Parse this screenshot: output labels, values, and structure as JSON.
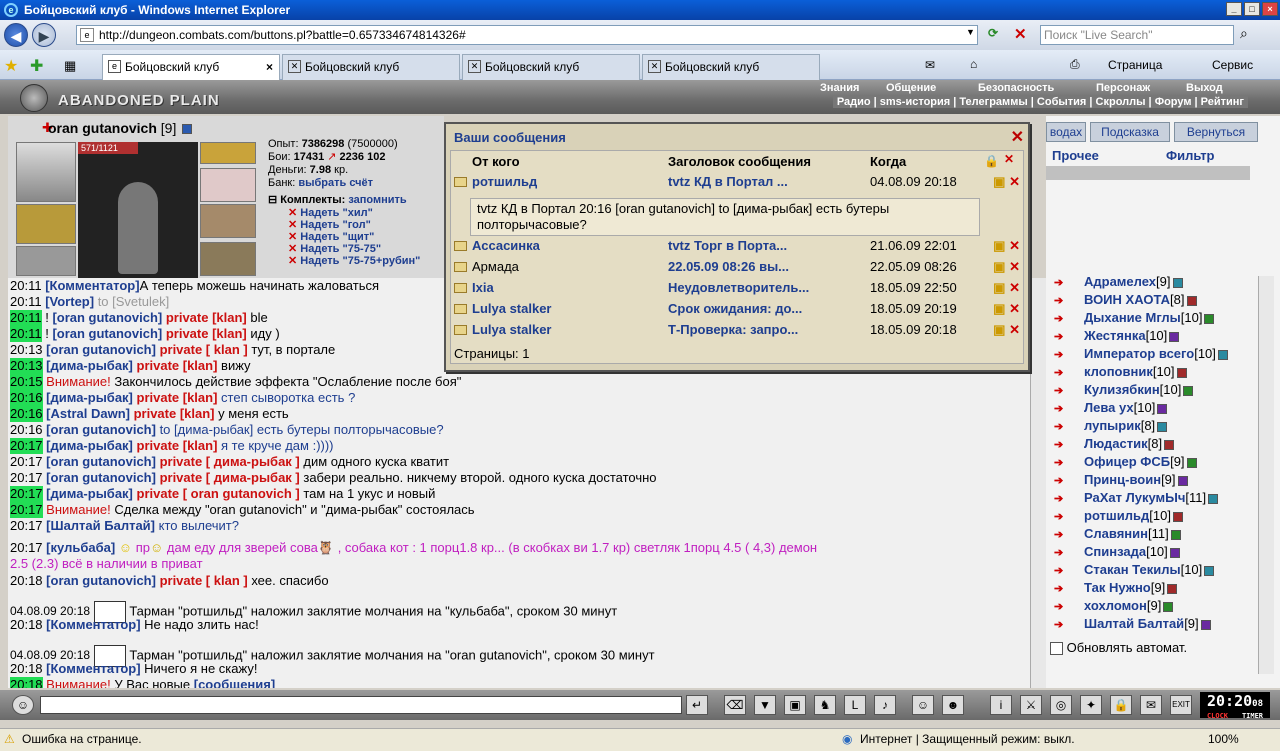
{
  "window": {
    "title": "Бойцовский клуб - Windows Internet Explorer",
    "min": "_",
    "max": "□",
    "close": "×"
  },
  "browser": {
    "url": "http://dungeon.combats.com/buttons.pl?battle=0.657334674814326#",
    "search_placeholder": "Поиск \"Live Search\"",
    "tabs": [
      "Бойцовский клуб",
      "Бойцовский клуб",
      "Бойцовский клуб",
      "Бойцовский клуб"
    ],
    "tab_close": "×",
    "page_menu": "Страница",
    "service_menu": "Сервис"
  },
  "game": {
    "logo": "ABANDONED PLAIN",
    "menu": [
      "Знания",
      "Общение",
      "Безопасность",
      "Персонаж",
      "Выход"
    ],
    "submenu": "Радио | sms-история | Телеграммы | События | Скроллы | Форум | Рейтинг"
  },
  "character": {
    "name": "oran gutanovich",
    "level": "[9]",
    "hp": "571/1121",
    "exp_label": "Опыт:",
    "exp": "7386298",
    "exp_next": "(7500000)",
    "fights_label": "Бои:",
    "wins": "17431",
    "losses": "2236",
    "draws": "102",
    "money_label": "Деньги:",
    "money": "7.98",
    "money_unit": "кр.",
    "bank_label": "Банк:",
    "bank_link": "выбрать счёт",
    "sets_label": "Комплекты:",
    "sets_remember": "запомнить",
    "sets": [
      "Надеть \"хил\"",
      "Надеть \"гол\"",
      "Надеть \"щит\"",
      "Надеть \"75-75\"",
      "Надеть \"75-75+рубин\""
    ]
  },
  "right_panel": {
    "btn_left": "водах",
    "btn_hint": "Подсказка",
    "btn_back": "Вернуться",
    "tab_other": "Прочее",
    "tab_filter": "Фильтр",
    "users": [
      {
        "name": "Адрамелех",
        "level": "[9]"
      },
      {
        "name": "ВОИН ХАОТА",
        "level": "[8]"
      },
      {
        "name": "Дыхание Мглы",
        "level": "[10]"
      },
      {
        "name": "Жестянка",
        "level": "[10]"
      },
      {
        "name": "Император всего",
        "level": "[10]"
      },
      {
        "name": "клоповник",
        "level": "[10]"
      },
      {
        "name": "Кулизябкин",
        "level": "[10]"
      },
      {
        "name": "Лева ух",
        "level": "[10]"
      },
      {
        "name": "лупырик",
        "level": "[8]"
      },
      {
        "name": "Людастик",
        "level": "[8]"
      },
      {
        "name": "Офицер ФСБ",
        "level": "[9]"
      },
      {
        "name": "Принц-воин",
        "level": "[9]"
      },
      {
        "name": "РаХат ЛукумЫч",
        "level": "[11]"
      },
      {
        "name": "ротшильд",
        "level": "[10]"
      },
      {
        "name": "Славянин",
        "level": "[11]"
      },
      {
        "name": "Спинзада",
        "level": "[10]"
      },
      {
        "name": "Стакан Текилы",
        "level": "[10]"
      },
      {
        "name": "Так Нужно",
        "level": "[9]"
      },
      {
        "name": "хохломон",
        "level": "[9]"
      },
      {
        "name": "Шалтай Балтай",
        "level": "[9]"
      }
    ],
    "auto_refresh": "Обновлять автомат."
  },
  "messages": {
    "title": "Ваши сообщения",
    "col_from": "От кого",
    "col_subject": "Заголовок сообщения",
    "col_when": "Когда",
    "rows": [
      {
        "from": "ротшильд",
        "subject": "tvtz КД в Портал ...",
        "when": "04.08.09 20:18"
      },
      {
        "from": "Ассасинка",
        "subject": "tvtz Торг в Порта...",
        "when": "21.06.09 22:01"
      },
      {
        "from": "Армада",
        "subject": "22.05.09 08:26 вы...",
        "when": "22.05.09 08:26"
      },
      {
        "from": "Ixia",
        "subject": "Неудовлетворитель...",
        "when": "18.05.09 22:50"
      },
      {
        "from": "Lulya stalker",
        "subject": "Срок ожидания: до...",
        "when": "18.05.09 20:19"
      },
      {
        "from": "Lulya stalker",
        "subject": "Т-Проверка: запро...",
        "when": "18.05.09 20:18"
      }
    ],
    "expanded_text": "tvtz КД в Портал 20:16 [oran gutanovich] to [дима-рыбак] есть бутеры полторычасовые?",
    "pages": "Страницы: 1"
  },
  "chat": [
    {
      "t": "20:11",
      "parts": [
        [
          "nm",
          "[Комментатор]"
        ],
        [
          "",
          "А теперь можешь начинать жаловаться"
        ]
      ]
    },
    {
      "t": "20:11",
      "parts": [
        [
          "nm",
          "[Vortep]"
        ],
        [
          "gry",
          " to [Svetulek]"
        ]
      ]
    },
    {
      "t": "20:11",
      "g": true,
      "parts": [
        [
          "",
          "! "
        ],
        [
          "nm",
          "[oran gutanovich]"
        ],
        [
          "pv",
          " private [klan] "
        ],
        [
          "",
          "ble"
        ]
      ]
    },
    {
      "t": "20:11",
      "g": true,
      "parts": [
        [
          "",
          "! "
        ],
        [
          "nm",
          "[oran gutanovich]"
        ],
        [
          "pv",
          " private [klan] "
        ],
        [
          "",
          "иду )"
        ]
      ]
    },
    {
      "t": "20:13",
      "parts": [
        [
          "nm",
          "[oran gutanovich]"
        ],
        [
          "pv",
          " private [ klan ] "
        ],
        [
          "",
          "тут, в портале"
        ]
      ]
    },
    {
      "t": "20:13",
      "g": true,
      "parts": [
        [
          "nm",
          "[дима-рыбак]"
        ],
        [
          "pv",
          " private [klan] "
        ],
        [
          "",
          "вижу"
        ]
      ]
    },
    {
      "t": "20:15",
      "g": true,
      "parts": [
        [
          "sys",
          "Внимание! "
        ],
        [
          "",
          "Закончилось действие эффекта \"Ослабление после боя\""
        ]
      ]
    },
    {
      "t": "20:16",
      "g": true,
      "parts": [
        [
          "nm",
          "[дима-рыбак]"
        ],
        [
          "pv",
          " private [klan] "
        ],
        [
          "blu",
          "степ сыворотка есть ?"
        ]
      ]
    },
    {
      "t": "20:16",
      "g": true,
      "parts": [
        [
          "nm",
          "[Astral Dawn]"
        ],
        [
          "pv",
          " private [klan] "
        ],
        [
          "",
          "у меня есть"
        ]
      ]
    },
    {
      "t": "20:16",
      "parts": [
        [
          "nm",
          "[oran gutanovich]"
        ],
        [
          "blu",
          " to [дима-рыбак] есть бутеры полторычасовые?"
        ]
      ]
    },
    {
      "t": "20:17",
      "g": true,
      "parts": [
        [
          "nm",
          "[дима-рыбак]"
        ],
        [
          "pv",
          " private [klan] "
        ],
        [
          "blu",
          "я те круче дам :))))"
        ]
      ]
    },
    {
      "t": "20:17",
      "parts": [
        [
          "nm",
          "[oran gutanovich]"
        ],
        [
          "pv",
          " private [ дима-рыбак ] "
        ],
        [
          "",
          "дим одного куска кватит"
        ]
      ]
    },
    {
      "t": "20:17",
      "parts": [
        [
          "nm",
          "[oran gutanovich]"
        ],
        [
          "pv",
          " private [ дима-рыбак ] "
        ],
        [
          "",
          "забери реально. никчему второй. одного куска достаточно"
        ]
      ]
    },
    {
      "t": "20:17",
      "g": true,
      "parts": [
        [
          "nm",
          "[дима-рыбак]"
        ],
        [
          "pv",
          " private [ oran gutanovich ] "
        ],
        [
          "",
          "там на 1 укус и новый"
        ]
      ]
    },
    {
      "t": "20:17",
      "g": true,
      "parts": [
        [
          "sys",
          "Внимание! "
        ],
        [
          "",
          "Сделка между \"oran gutanovich\" и \"дима-рыбак\" состоялась"
        ]
      ]
    },
    {
      "t": "20:17",
      "parts": [
        [
          "nm",
          "[Шалтай Балтай]"
        ],
        [
          "blu",
          " кто вылечит?"
        ]
      ]
    }
  ],
  "chat2": {
    "kulbaba_t": "20:17",
    "kulbaba_nm": "[кульбаба]",
    "kulbaba_msg1": "пр",
    "kulbaba_msg2": "дам еду для зверей сова",
    "kulbaba_msg3": ", собака кот : 1 порц1.8 кр... (в скобках ви 1.7 кр) светляк 1порц 4.5 ( 4,3) демон",
    "kulbaba_msg4": "2.5 (2.3) всё в наличии в приват",
    "l1_t": "20:18",
    "l1_nm": "[oran gutanovich]",
    "l1_pv": " private [ klan ] ",
    "l1_msg": "хее. спасибо",
    "l2_t": "04.08.09 20:18",
    "l2_msg": "Тарман \"ротшильд\" наложил заклятие молчания на \"кульбаба\", сроком 30 минут",
    "l3_t": "20:18",
    "l3_nm": "[Комментатор]",
    "l3_msg": "Не надо злить нас!",
    "l4_t": "04.08.09 20:18",
    "l4_msg": "Тарман \"ротшильд\" наложил заклятие молчания на \"oran gutanovich\", сроком 30 минут",
    "l5_t": "20:18",
    "l5_nm": "[Комментатор]",
    "l5_msg": "Ничего я не скажу!",
    "l6_t": "20:18",
    "l6_sys": "Внимание! ",
    "l6_msg": "У Вас новые ",
    "l6_link": "[сообщения]"
  },
  "clock": {
    "time": "20:20",
    "sec": "08",
    "l1": "CLOCK",
    "l2": "TIMER"
  },
  "statusbar": {
    "error": "Ошибка на странице.",
    "zone": "Интернет | Защищенный режим: выкл.",
    "zoom": "100%"
  }
}
